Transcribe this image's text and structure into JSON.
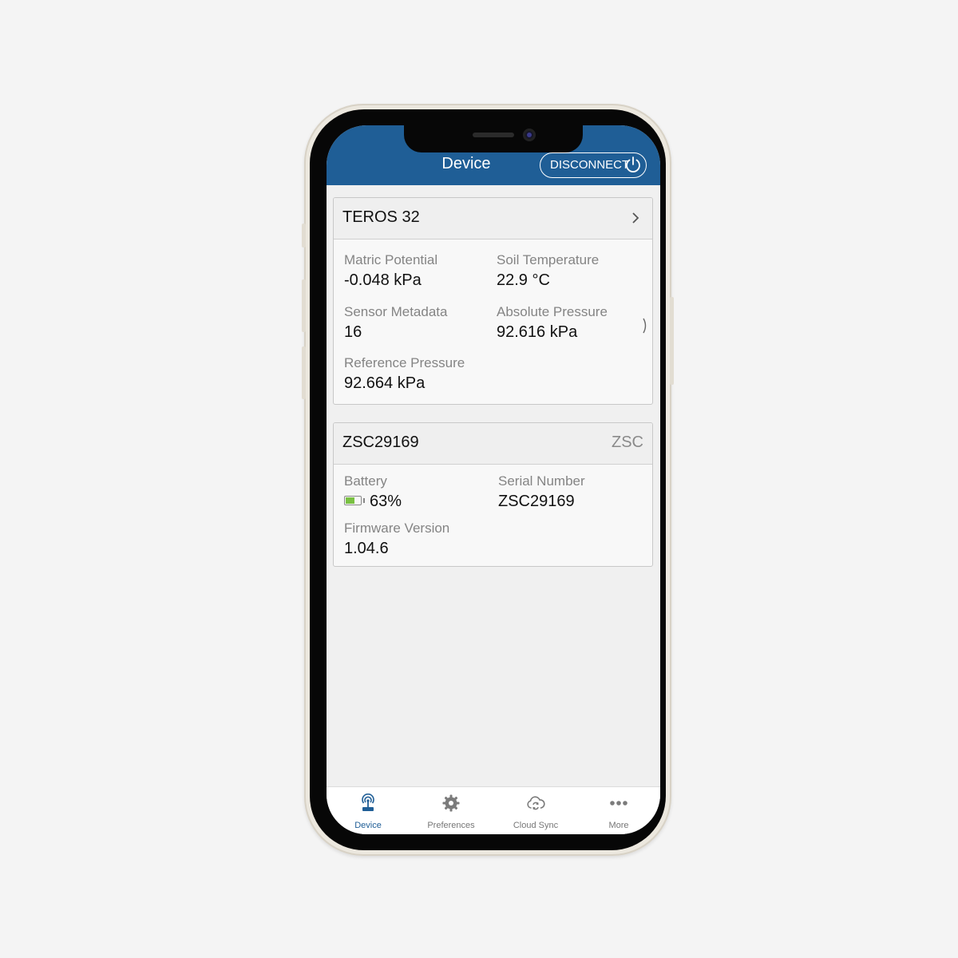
{
  "header": {
    "title": "Device",
    "disconnect_label": "DISCONNECT"
  },
  "sensor_card": {
    "title": "TEROS 32",
    "fields": [
      {
        "label": "Matric Potential",
        "value": "-0.048 kPa"
      },
      {
        "label": "Soil Temperature",
        "value": "22.9 °C"
      },
      {
        "label": "Sensor Metadata",
        "value": "16"
      },
      {
        "label": "Absolute Pressure",
        "value": "92.616 kPa"
      },
      {
        "label": "Reference Pressure",
        "value": "92.664 kPa"
      }
    ]
  },
  "logger_card": {
    "title": "ZSC29169",
    "tag": "ZSC",
    "battery": {
      "label": "Battery",
      "value": "63%",
      "level": 0.63
    },
    "fields": [
      {
        "label": "Serial Number",
        "value": "ZSC29169"
      },
      {
        "label": "Firmware Version",
        "value": "1.04.6"
      }
    ]
  },
  "tabbar": {
    "tabs": [
      {
        "label": "Device",
        "icon": "device-antenna-icon",
        "active": true
      },
      {
        "label": "Preferences",
        "icon": "gear-icon",
        "active": false
      },
      {
        "label": "Cloud Sync",
        "icon": "cloud-sync-icon",
        "active": false
      },
      {
        "label": "More",
        "icon": "more-dots-icon",
        "active": false
      }
    ]
  },
  "colors": {
    "brand_blue": "#1f5e96",
    "battery_green": "#7ac143",
    "label_gray": "#848484"
  }
}
